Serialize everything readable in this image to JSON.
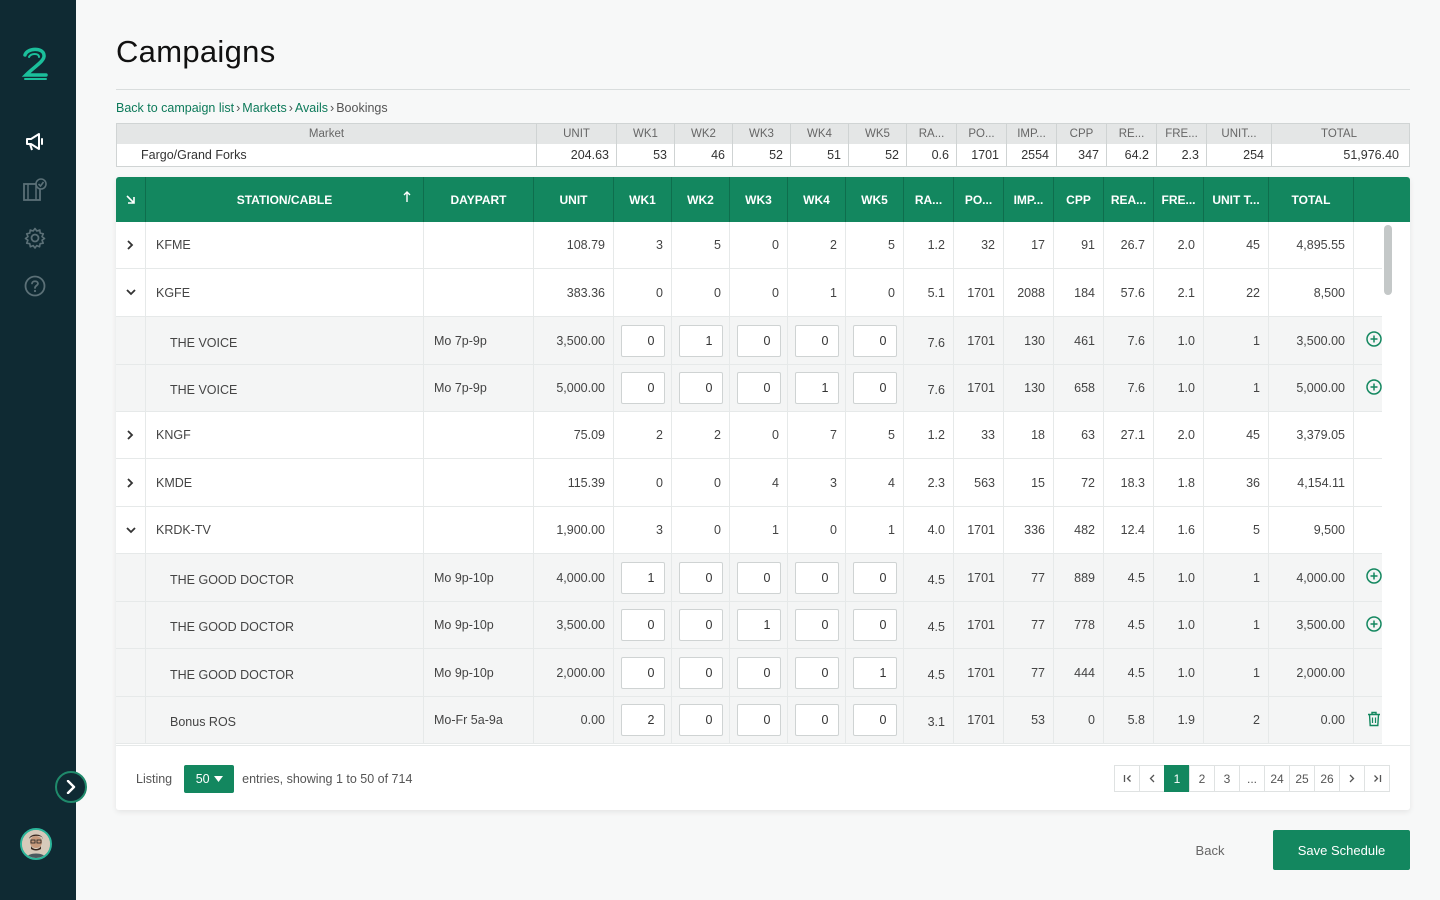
{
  "app": {
    "colors": {
      "sidebar": "#0f2a33",
      "accent": "#13875f",
      "accent_text": "#0d7a5a"
    }
  },
  "sidebar": {
    "logo": "2",
    "items": [
      {
        "icon": "megaphone-icon",
        "active": true
      },
      {
        "icon": "film-check-icon",
        "active": false
      },
      {
        "icon": "gear-icon",
        "active": false
      },
      {
        "icon": "help-icon",
        "active": false
      }
    ],
    "expand_icon": "chevron-right-icon"
  },
  "page": {
    "title": "Campaigns"
  },
  "breadcrumb": {
    "items": [
      "Back to campaign list",
      "Markets",
      "Avails"
    ],
    "current": "Bookings",
    "separator": "›"
  },
  "summary": {
    "headers": [
      "Market",
      "UNIT",
      "WK1",
      "WK2",
      "WK3",
      "WK4",
      "WK5",
      "RA...",
      "PO...",
      "IMP...",
      "CPP",
      "RE...",
      "FRE...",
      "UNIT...",
      "TOTAL"
    ],
    "row": [
      "Fargo/Grand Forks",
      "204.63",
      "53",
      "46",
      "52",
      "51",
      "52",
      "0.6",
      "1701",
      "2554",
      "347",
      "64.2",
      "2.3",
      "254",
      "51,976.40"
    ]
  },
  "table": {
    "sort_icon": "arrow-up-icon",
    "collapse_icon": "collapse-arrow-icon",
    "headers": {
      "station": "STATION/CABLE",
      "daypart": "DAYPART",
      "unit": "UNIT",
      "wk1": "WK1",
      "wk2": "WK2",
      "wk3": "WK3",
      "wk4": "WK4",
      "wk5": "WK5",
      "ra": "RA...",
      "po": "PO...",
      "imp": "IMP...",
      "cpp": "CPP",
      "rea": "REA...",
      "fre": "FRE...",
      "unit_t": "UNIT T...",
      "total": "TOTAL"
    },
    "rows": [
      {
        "type": "station",
        "expanded": false,
        "station": "KFME",
        "daypart": "",
        "unit": "108.79",
        "wk": [
          "3",
          "5",
          "0",
          "2",
          "5"
        ],
        "ra": "1.2",
        "po": "32",
        "imp": "17",
        "cpp": "91",
        "rea": "26.7",
        "fre": "2.0",
        "unit_t": "45",
        "total": "4,895.55",
        "action": ""
      },
      {
        "type": "station",
        "expanded": true,
        "station": "KGFE",
        "daypart": "",
        "unit": "383.36",
        "wk": [
          "0",
          "0",
          "0",
          "1",
          "0"
        ],
        "ra": "5.1",
        "po": "1701",
        "imp": "2088",
        "cpp": "184",
        "rea": "57.6",
        "fre": "2.1",
        "unit_t": "22",
        "total": "8,500",
        "action": ""
      },
      {
        "type": "program",
        "station": "THE VOICE",
        "daypart": "Mo 7p-9p",
        "unit": "3,500.00",
        "wk": [
          "0",
          "1",
          "0",
          "0",
          "0"
        ],
        "ra": "7.6",
        "po": "1701",
        "imp": "130",
        "cpp": "461",
        "rea": "7.6",
        "fre": "1.0",
        "unit_t": "1",
        "total": "3,500.00",
        "action": "add"
      },
      {
        "type": "program",
        "station": "THE VOICE",
        "daypart": "Mo 7p-9p",
        "unit": "5,000.00",
        "wk": [
          "0",
          "0",
          "0",
          "1",
          "0"
        ],
        "ra": "7.6",
        "po": "1701",
        "imp": "130",
        "cpp": "658",
        "rea": "7.6",
        "fre": "1.0",
        "unit_t": "1",
        "total": "5,000.00",
        "action": "add"
      },
      {
        "type": "station",
        "expanded": false,
        "station": "KNGF",
        "daypart": "",
        "unit": "75.09",
        "wk": [
          "2",
          "2",
          "0",
          "7",
          "5"
        ],
        "ra": "1.2",
        "po": "33",
        "imp": "18",
        "cpp": "63",
        "rea": "27.1",
        "fre": "2.0",
        "unit_t": "45",
        "total": "3,379.05",
        "action": ""
      },
      {
        "type": "station",
        "expanded": false,
        "station": "KMDE",
        "daypart": "",
        "unit": "115.39",
        "wk": [
          "0",
          "0",
          "4",
          "3",
          "4"
        ],
        "ra": "2.3",
        "po": "563",
        "imp": "15",
        "cpp": "72",
        "rea": "18.3",
        "fre": "1.8",
        "unit_t": "36",
        "total": "4,154.11",
        "action": ""
      },
      {
        "type": "station",
        "expanded": true,
        "station": "KRDK-TV",
        "daypart": "",
        "unit": "1,900.00",
        "wk": [
          "3",
          "0",
          "1",
          "0",
          "1"
        ],
        "ra": "4.0",
        "po": "1701",
        "imp": "336",
        "cpp": "482",
        "rea": "12.4",
        "fre": "1.6",
        "unit_t": "5",
        "total": "9,500",
        "action": ""
      },
      {
        "type": "program",
        "station": "THE GOOD DOCTOR",
        "daypart": "Mo 9p-10p",
        "unit": "4,000.00",
        "wk": [
          "1",
          "0",
          "0",
          "0",
          "0"
        ],
        "ra": "4.5",
        "po": "1701",
        "imp": "77",
        "cpp": "889",
        "rea": "4.5",
        "fre": "1.0",
        "unit_t": "1",
        "total": "4,000.00",
        "action": "add"
      },
      {
        "type": "program",
        "station": "THE GOOD DOCTOR",
        "daypart": "Mo 9p-10p",
        "unit": "3,500.00",
        "wk": [
          "0",
          "0",
          "1",
          "0",
          "0"
        ],
        "ra": "4.5",
        "po": "1701",
        "imp": "77",
        "cpp": "778",
        "rea": "4.5",
        "fre": "1.0",
        "unit_t": "1",
        "total": "3,500.00",
        "action": "add"
      },
      {
        "type": "program",
        "station": "THE GOOD DOCTOR",
        "daypart": "Mo 9p-10p",
        "unit": "2,000.00",
        "wk": [
          "0",
          "0",
          "0",
          "0",
          "1"
        ],
        "ra": "4.5",
        "po": "1701",
        "imp": "77",
        "cpp": "444",
        "rea": "4.5",
        "fre": "1.0",
        "unit_t": "1",
        "total": "2,000.00",
        "action": ""
      },
      {
        "type": "program",
        "station": "Bonus ROS",
        "daypart": "Mo-Fr 5a-9a",
        "unit": "0.00",
        "wk": [
          "2",
          "0",
          "0",
          "0",
          "0"
        ],
        "ra": "3.1",
        "po": "1701",
        "imp": "53",
        "cpp": "0",
        "rea": "5.8",
        "fre": "1.9",
        "unit_t": "2",
        "total": "0.00",
        "action": "delete"
      }
    ]
  },
  "footer": {
    "listing_label": "Listing",
    "page_size": "50",
    "entries_text": "entries, showing 1 to 50 of 714",
    "pages": [
      "1",
      "2",
      "3",
      "...",
      "24",
      "25",
      "26"
    ],
    "current_page": "1"
  },
  "actions": {
    "back": "Back",
    "save": "Save Schedule"
  }
}
